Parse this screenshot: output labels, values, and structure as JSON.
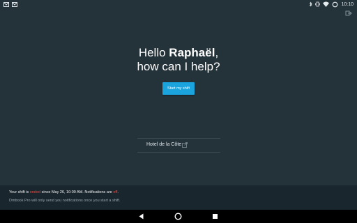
{
  "status_bar": {
    "time": "10:10",
    "left_icons": [
      "gmail-icon",
      "gmail-icon"
    ],
    "right_icons": [
      "bluetooth-icon",
      "vibrate-icon",
      "wifi-icon",
      "battery-icon"
    ]
  },
  "header": {
    "exit_icon": "exit-icon"
  },
  "greeting": {
    "hello": "Hello ",
    "name": "Raphaël",
    "comma": ",",
    "line2": "how can I help?"
  },
  "start_button": {
    "label": "Start my shift"
  },
  "hotel": {
    "name": "Hotel de la Côte",
    "link_icon": "external-link-icon"
  },
  "banner": {
    "part1": "Your shift is ",
    "ended": "ended",
    "part2": " since May 26, 10:09 AM. Notifications are ",
    "off": "off",
    "part3": ".",
    "line2": "Dmbook Pro will only send you notifications once you start a shift."
  },
  "colors": {
    "background": "#24323a",
    "accent": "#1aa3dd",
    "alert": "#f0473c",
    "banner": "#1a262d"
  },
  "nav_icons": [
    "back-icon",
    "home-icon",
    "recents-icon"
  ]
}
